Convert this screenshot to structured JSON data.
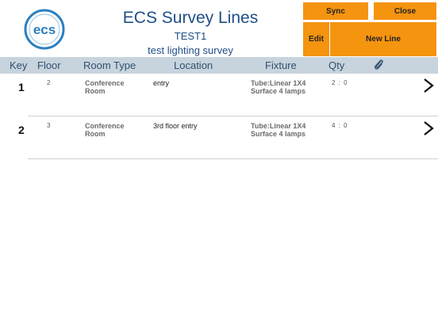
{
  "logo_text": "ecs",
  "header": {
    "title": "ECS Survey Lines",
    "subtitle": "TEST1",
    "description": "test lighting survey"
  },
  "buttons": {
    "sync": "Sync",
    "close": "Close",
    "edit": "Edit",
    "new_line": "New Line"
  },
  "columns": {
    "key": "Key",
    "floor": "Floor",
    "room_type": "Room Type",
    "location": "Location",
    "fixture": "Fixture",
    "qty": "Qty",
    "attachment_icon": "paperclip-icon"
  },
  "rows": [
    {
      "key": "1",
      "floor": "2",
      "room_type": "Conference Room",
      "location": "entry",
      "fixture": "Tube:Linear 1X4 Surface 4 lamps",
      "qty": "2 : 0"
    },
    {
      "key": "2",
      "floor": "3",
      "room_type": "Conference Room",
      "location": "3rd floor entry",
      "fixture": "Tube:Linear 1X4 Surface 4 lamps",
      "qty": "4 : 0"
    }
  ],
  "colors": {
    "accent": "#f5940f",
    "header_bg": "#c7d4de",
    "title": "#1f4e86",
    "logo": "#2a7fc0"
  }
}
